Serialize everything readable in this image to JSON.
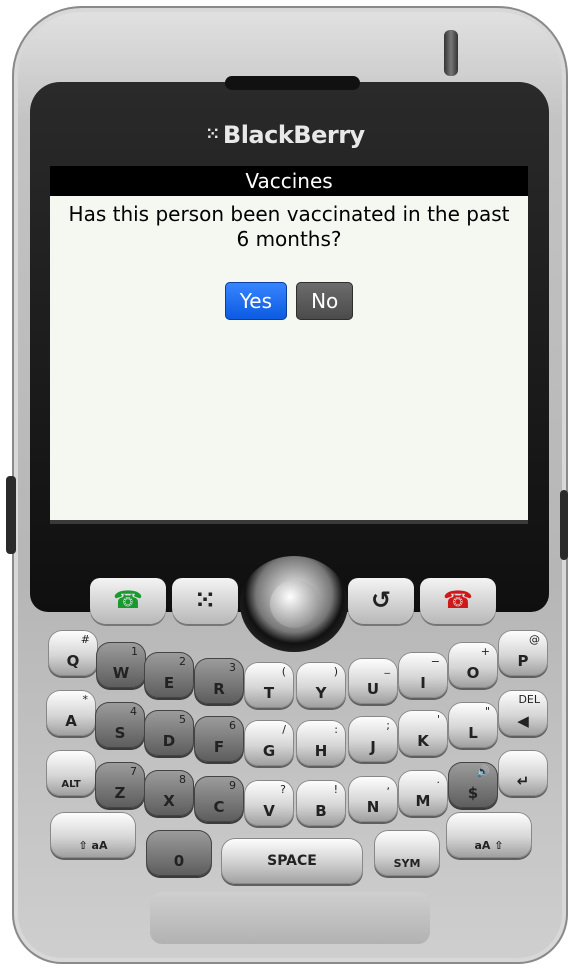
{
  "device": {
    "brand": "BlackBerry",
    "brand_mark": "⁙"
  },
  "screen": {
    "title": "Vaccines",
    "question": "Has this person been vaccinated in the past 6 months?",
    "buttons": {
      "yes": "Yes",
      "no": "No"
    }
  },
  "nav_keys": {
    "call": "☎",
    "menu": "⁙",
    "back": "↺",
    "end": "☎"
  },
  "keyboard": {
    "row1": [
      {
        "sec": "#",
        "pri": "Q"
      },
      {
        "sec": "1",
        "pri": "W"
      },
      {
        "sec": "2",
        "pri": "E"
      },
      {
        "sec": "3",
        "pri": "R"
      },
      {
        "sec": "(",
        "pri": "T"
      },
      {
        "sec": ")",
        "pri": "Y"
      },
      {
        "sec": "_",
        "pri": "U"
      },
      {
        "sec": "−",
        "pri": "I"
      },
      {
        "sec": "+",
        "pri": "O"
      },
      {
        "sec": "@",
        "pri": "P"
      }
    ],
    "row2": [
      {
        "sec": "*",
        "pri": "A"
      },
      {
        "sec": "4",
        "pri": "S"
      },
      {
        "sec": "5",
        "pri": "D"
      },
      {
        "sec": "6",
        "pri": "F"
      },
      {
        "sec": "/",
        "pri": "G"
      },
      {
        "sec": ":",
        "pri": "H"
      },
      {
        "sec": ";",
        "pri": "J"
      },
      {
        "sec": "'",
        "pri": "K"
      },
      {
        "sec": "\"",
        "pri": "L"
      },
      {
        "sec": "DEL",
        "pri": "◀"
      }
    ],
    "row3": [
      {
        "sec": "",
        "pri": "ALT"
      },
      {
        "sec": "7",
        "pri": "Z"
      },
      {
        "sec": "8",
        "pri": "X"
      },
      {
        "sec": "9",
        "pri": "C"
      },
      {
        "sec": "?",
        "pri": "V"
      },
      {
        "sec": "!",
        "pri": "B"
      },
      {
        "sec": ",",
        "pri": "N"
      },
      {
        "sec": ".",
        "pri": "M"
      },
      {
        "sec": "🔊",
        "pri": "$"
      },
      {
        "sec": "",
        "pri": "↵"
      }
    ],
    "row4": [
      {
        "sec": "",
        "pri": "⇧ aA"
      },
      {
        "sec": "",
        "pri": "0"
      },
      {
        "sec": "",
        "pri": "SPACE"
      },
      {
        "sec": "",
        "pri": "SYM"
      },
      {
        "sec": "",
        "pri": "aA ⇧"
      }
    ]
  }
}
